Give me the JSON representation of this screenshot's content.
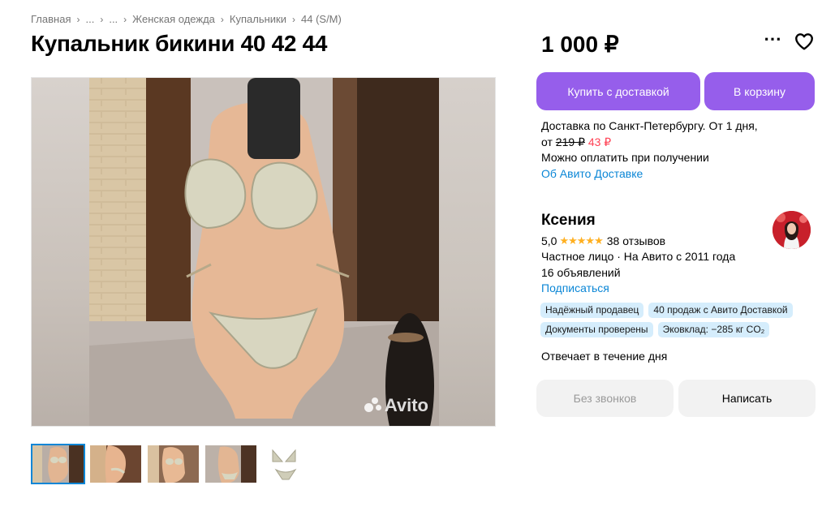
{
  "breadcrumb": [
    "Главная",
    "...",
    "...",
    "Женская одежда",
    "Купальники",
    "44 (S/M)"
  ],
  "title": "Купальник бикини 40 42 44",
  "price": "1 000 ₽",
  "watermark": "Avito",
  "actions": {
    "buy_delivery": "Купить с доставкой",
    "add_to_cart": "В корзину"
  },
  "delivery": {
    "line1": "Доставка по Санкт-Петербургу. От 1 дня,",
    "from": "от",
    "old_price": "219 ₽",
    "new_price": "43 ₽",
    "cod": "Можно оплатить при получении",
    "link": "Об Авито Доставке"
  },
  "seller": {
    "name": "Ксения",
    "rating": "5,0",
    "stars": "★★★★★",
    "reviews": "38 отзывов",
    "type": "Частное лицо · На Авито с 2011 года",
    "listings": "16 объявлений",
    "subscribe": "Подписаться"
  },
  "badges": [
    "Надёжный продавец",
    "40 продаж с Авито Доставкой",
    "Документы проверены",
    "Эковклад: −285 кг CO₂"
  ],
  "reply_time": "Отвечает в течение дня",
  "contact": {
    "no_calls": "Без звонков",
    "write": "Написать"
  },
  "colors": {
    "accent": "#965eeb",
    "link": "#0a86d6",
    "badge_bg": "#d5edfc",
    "star": "#ffb021",
    "new_price": "#ff4053"
  },
  "thumbnails_count": 5
}
